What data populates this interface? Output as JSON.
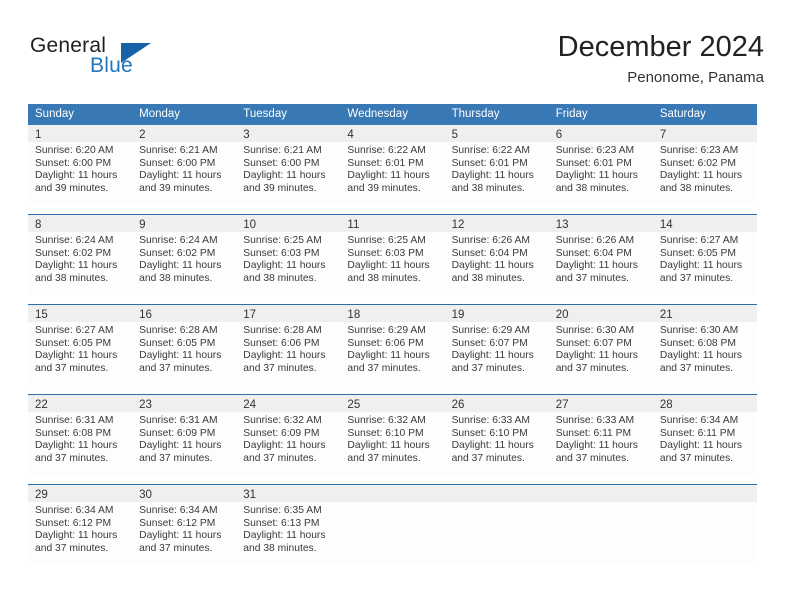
{
  "brand": {
    "name_part1": "General",
    "name_part2": "Blue",
    "accent_color": "#2176bd",
    "triangle_color": "#1464a5"
  },
  "header": {
    "title": "December 2024",
    "subtitle": "Penonome, Panama"
  },
  "theme": {
    "header_row_color": "#3878b4",
    "week_divider_color": "#2c6ca8",
    "day_band_color": "#efefef",
    "cell_background": "#fdfdfd"
  },
  "weekdays": [
    "Sunday",
    "Monday",
    "Tuesday",
    "Wednesday",
    "Thursday",
    "Friday",
    "Saturday"
  ],
  "weeks": [
    [
      {
        "day": "1",
        "lines": [
          "Sunrise: 6:20 AM",
          "Sunset: 6:00 PM",
          "Daylight: 11 hours",
          "and 39 minutes."
        ]
      },
      {
        "day": "2",
        "lines": [
          "Sunrise: 6:21 AM",
          "Sunset: 6:00 PM",
          "Daylight: 11 hours",
          "and 39 minutes."
        ]
      },
      {
        "day": "3",
        "lines": [
          "Sunrise: 6:21 AM",
          "Sunset: 6:00 PM",
          "Daylight: 11 hours",
          "and 39 minutes."
        ]
      },
      {
        "day": "4",
        "lines": [
          "Sunrise: 6:22 AM",
          "Sunset: 6:01 PM",
          "Daylight: 11 hours",
          "and 39 minutes."
        ]
      },
      {
        "day": "5",
        "lines": [
          "Sunrise: 6:22 AM",
          "Sunset: 6:01 PM",
          "Daylight: 11 hours",
          "and 38 minutes."
        ]
      },
      {
        "day": "6",
        "lines": [
          "Sunrise: 6:23 AM",
          "Sunset: 6:01 PM",
          "Daylight: 11 hours",
          "and 38 minutes."
        ]
      },
      {
        "day": "7",
        "lines": [
          "Sunrise: 6:23 AM",
          "Sunset: 6:02 PM",
          "Daylight: 11 hours",
          "and 38 minutes."
        ]
      }
    ],
    [
      {
        "day": "8",
        "lines": [
          "Sunrise: 6:24 AM",
          "Sunset: 6:02 PM",
          "Daylight: 11 hours",
          "and 38 minutes."
        ]
      },
      {
        "day": "9",
        "lines": [
          "Sunrise: 6:24 AM",
          "Sunset: 6:02 PM",
          "Daylight: 11 hours",
          "and 38 minutes."
        ]
      },
      {
        "day": "10",
        "lines": [
          "Sunrise: 6:25 AM",
          "Sunset: 6:03 PM",
          "Daylight: 11 hours",
          "and 38 minutes."
        ]
      },
      {
        "day": "11",
        "lines": [
          "Sunrise: 6:25 AM",
          "Sunset: 6:03 PM",
          "Daylight: 11 hours",
          "and 38 minutes."
        ]
      },
      {
        "day": "12",
        "lines": [
          "Sunrise: 6:26 AM",
          "Sunset: 6:04 PM",
          "Daylight: 11 hours",
          "and 38 minutes."
        ]
      },
      {
        "day": "13",
        "lines": [
          "Sunrise: 6:26 AM",
          "Sunset: 6:04 PM",
          "Daylight: 11 hours",
          "and 37 minutes."
        ]
      },
      {
        "day": "14",
        "lines": [
          "Sunrise: 6:27 AM",
          "Sunset: 6:05 PM",
          "Daylight: 11 hours",
          "and 37 minutes."
        ]
      }
    ],
    [
      {
        "day": "15",
        "lines": [
          "Sunrise: 6:27 AM",
          "Sunset: 6:05 PM",
          "Daylight: 11 hours",
          "and 37 minutes."
        ]
      },
      {
        "day": "16",
        "lines": [
          "Sunrise: 6:28 AM",
          "Sunset: 6:05 PM",
          "Daylight: 11 hours",
          "and 37 minutes."
        ]
      },
      {
        "day": "17",
        "lines": [
          "Sunrise: 6:28 AM",
          "Sunset: 6:06 PM",
          "Daylight: 11 hours",
          "and 37 minutes."
        ]
      },
      {
        "day": "18",
        "lines": [
          "Sunrise: 6:29 AM",
          "Sunset: 6:06 PM",
          "Daylight: 11 hours",
          "and 37 minutes."
        ]
      },
      {
        "day": "19",
        "lines": [
          "Sunrise: 6:29 AM",
          "Sunset: 6:07 PM",
          "Daylight: 11 hours",
          "and 37 minutes."
        ]
      },
      {
        "day": "20",
        "lines": [
          "Sunrise: 6:30 AM",
          "Sunset: 6:07 PM",
          "Daylight: 11 hours",
          "and 37 minutes."
        ]
      },
      {
        "day": "21",
        "lines": [
          "Sunrise: 6:30 AM",
          "Sunset: 6:08 PM",
          "Daylight: 11 hours",
          "and 37 minutes."
        ]
      }
    ],
    [
      {
        "day": "22",
        "lines": [
          "Sunrise: 6:31 AM",
          "Sunset: 6:08 PM",
          "Daylight: 11 hours",
          "and 37 minutes."
        ]
      },
      {
        "day": "23",
        "lines": [
          "Sunrise: 6:31 AM",
          "Sunset: 6:09 PM",
          "Daylight: 11 hours",
          "and 37 minutes."
        ]
      },
      {
        "day": "24",
        "lines": [
          "Sunrise: 6:32 AM",
          "Sunset: 6:09 PM",
          "Daylight: 11 hours",
          "and 37 minutes."
        ]
      },
      {
        "day": "25",
        "lines": [
          "Sunrise: 6:32 AM",
          "Sunset: 6:10 PM",
          "Daylight: 11 hours",
          "and 37 minutes."
        ]
      },
      {
        "day": "26",
        "lines": [
          "Sunrise: 6:33 AM",
          "Sunset: 6:10 PM",
          "Daylight: 11 hours",
          "and 37 minutes."
        ]
      },
      {
        "day": "27",
        "lines": [
          "Sunrise: 6:33 AM",
          "Sunset: 6:11 PM",
          "Daylight: 11 hours",
          "and 37 minutes."
        ]
      },
      {
        "day": "28",
        "lines": [
          "Sunrise: 6:34 AM",
          "Sunset: 6:11 PM",
          "Daylight: 11 hours",
          "and 37 minutes."
        ]
      }
    ],
    [
      {
        "day": "29",
        "lines": [
          "Sunrise: 6:34 AM",
          "Sunset: 6:12 PM",
          "Daylight: 11 hours",
          "and 37 minutes."
        ]
      },
      {
        "day": "30",
        "lines": [
          "Sunrise: 6:34 AM",
          "Sunset: 6:12 PM",
          "Daylight: 11 hours",
          "and 37 minutes."
        ]
      },
      {
        "day": "31",
        "lines": [
          "Sunrise: 6:35 AM",
          "Sunset: 6:13 PM",
          "Daylight: 11 hours",
          "and 38 minutes."
        ]
      },
      {
        "day": "",
        "lines": []
      },
      {
        "day": "",
        "lines": []
      },
      {
        "day": "",
        "lines": []
      },
      {
        "day": "",
        "lines": []
      }
    ]
  ]
}
